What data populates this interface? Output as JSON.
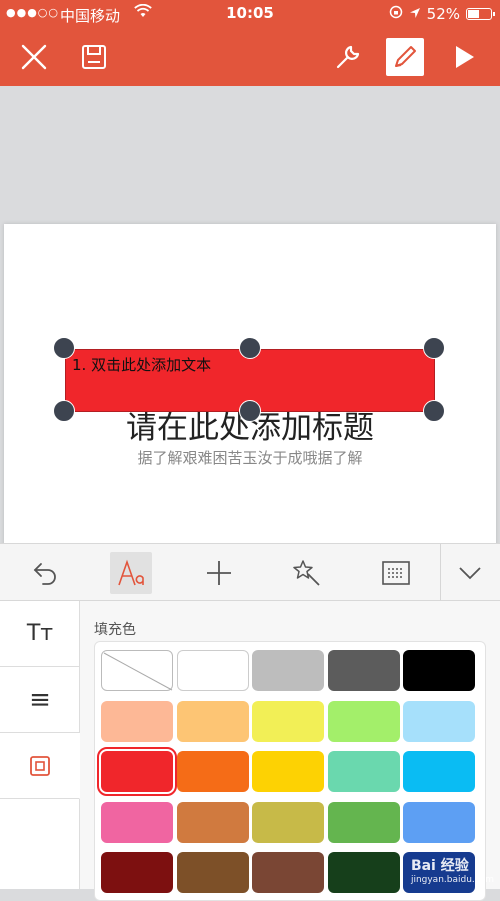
{
  "status": {
    "signal": "●●●○○",
    "carrier": "中国移动",
    "time": "10:05",
    "battery_percent": "52%",
    "battery_level": 0.52
  },
  "toolbar": {
    "close_icon": "close-icon",
    "save_icon": "save-icon",
    "tools_icon": "wrench-icon",
    "edit_icon": "pencil-icon",
    "play_icon": "play-icon",
    "accent": "#e2553c"
  },
  "slide": {
    "shape_text": "1.  双击此处添加文本",
    "title": "请在此处添加标题",
    "subtitle": "据了解艰难困苦玉汝于成哦据了解"
  },
  "format_bar": {
    "items": [
      "undo-icon",
      "text-format-icon",
      "add-icon",
      "magic-wand-icon",
      "textbox-icon",
      "chevron-down-icon"
    ]
  },
  "side_tabs": [
    {
      "label": "Tт"
    },
    {
      "label": "≡"
    },
    {
      "label": "▣"
    }
  ],
  "palette": {
    "label": "填充色",
    "rows": [
      [
        "none",
        "#ffffff",
        "#bdbdbd",
        "#5c5c5c",
        "#000000"
      ],
      [
        "#fdb896",
        "#fdc574",
        "#f2ef56",
        "#a3ef6a",
        "#a6e0fb"
      ],
      [
        "#f0262b",
        "#f56c17",
        "#fdd203",
        "#6ad8ae",
        "#0abcf3"
      ],
      [
        "#f065a1",
        "#d07a3f",
        "#c7ba48",
        "#64b54f",
        "#5d9ff3"
      ],
      [
        "#7d1010",
        "#7d5028",
        "#7a4634",
        "#163f1b",
        "#163b8f"
      ]
    ],
    "selected": "#f0262b"
  },
  "watermark": {
    "brand": "Bai 经验",
    "url": "jingyan.baidu.com"
  }
}
